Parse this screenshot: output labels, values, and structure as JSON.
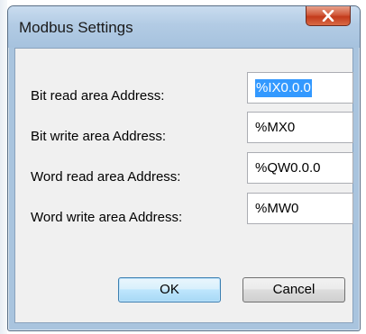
{
  "window": {
    "title": "Modbus Settings"
  },
  "fields": [
    {
      "label": "Bit read area Address:",
      "value": "%IX0.0.0"
    },
    {
      "label": "Bit write area Address:",
      "value": "%MX0"
    },
    {
      "label": "Word read area Address:",
      "value": "%QW0.0.0"
    },
    {
      "label": "Word write area Address:",
      "value": "%MW0"
    }
  ],
  "buttons": {
    "ok": "OK",
    "cancel": "Cancel"
  },
  "icons": {
    "close": "close-icon"
  },
  "colors": {
    "selection": "#3399ff",
    "close_button": "#c33a1b",
    "frame": "#a9c4de"
  }
}
